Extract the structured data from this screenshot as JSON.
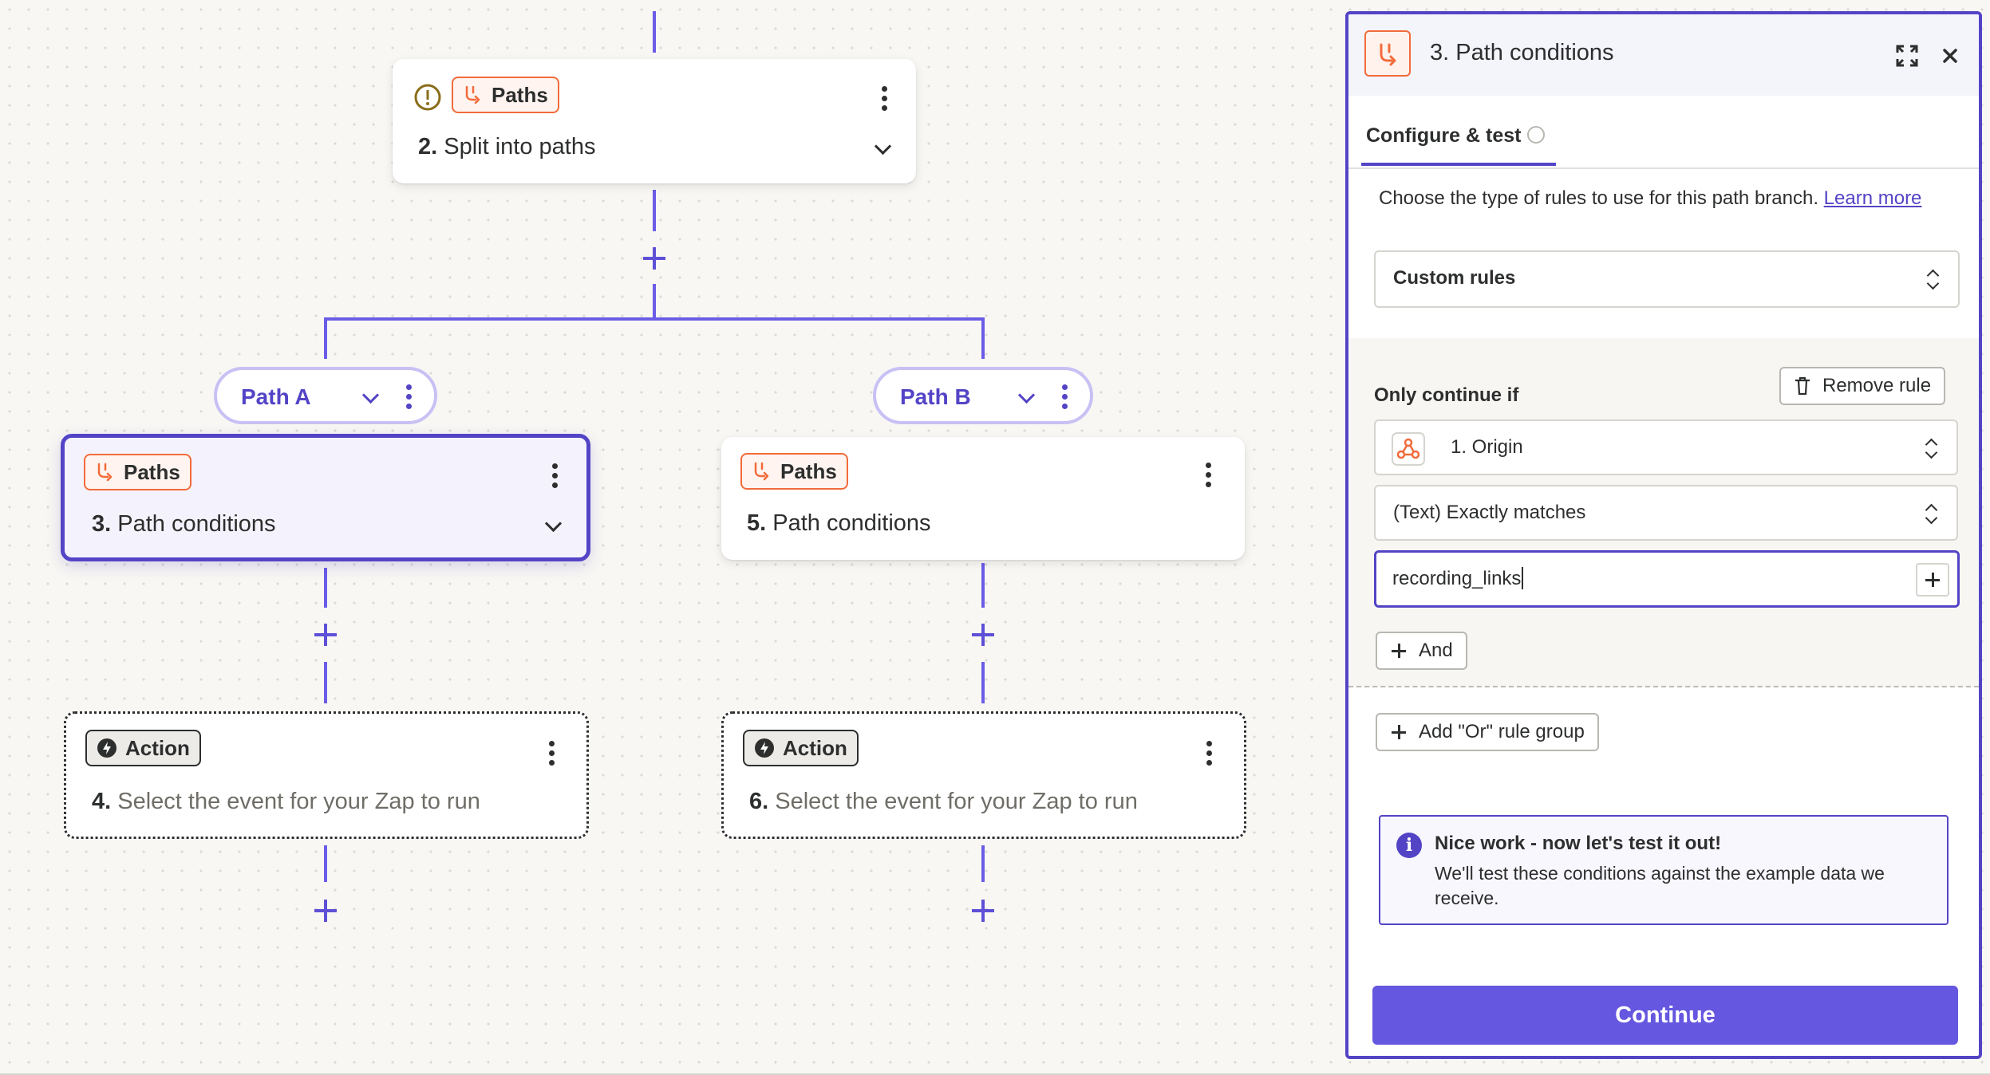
{
  "canvas": {
    "split_node": {
      "badge": "Paths",
      "step_num": "2.",
      "title": "Split into paths"
    },
    "path_a": {
      "label": "Path A"
    },
    "path_b": {
      "label": "Path B"
    },
    "node_3": {
      "badge": "Paths",
      "step_num": "3.",
      "title": "Path conditions"
    },
    "node_5": {
      "badge": "Paths",
      "step_num": "5.",
      "title": "Path conditions"
    },
    "node_4": {
      "badge": "Action",
      "step_num": "4.",
      "title": "Select the event for your Zap to run"
    },
    "node_6": {
      "badge": "Action",
      "step_num": "6.",
      "title": "Select the event for your Zap to run"
    }
  },
  "panel": {
    "step_title": "3. Path conditions",
    "tab_label": "Configure & test",
    "description": "Choose the type of rules to use for this path branch.",
    "learn_more": "Learn more",
    "rule_type": "Custom rules",
    "only_continue_if": "Only continue if",
    "remove_rule": "Remove rule",
    "field": "1. Origin",
    "operator": "(Text) Exactly matches",
    "value": "recording_links",
    "and_button": "And",
    "or_group_button": "Add \"Or\" rule group",
    "info_title": "Nice work - now let's test it out!",
    "info_body": "We'll test these conditions against the example data we receive.",
    "continue_button": "Continue"
  },
  "colors": {
    "accent": "#5344c6",
    "paths_orange": "#f26b3a",
    "continue": "#6557e0"
  }
}
